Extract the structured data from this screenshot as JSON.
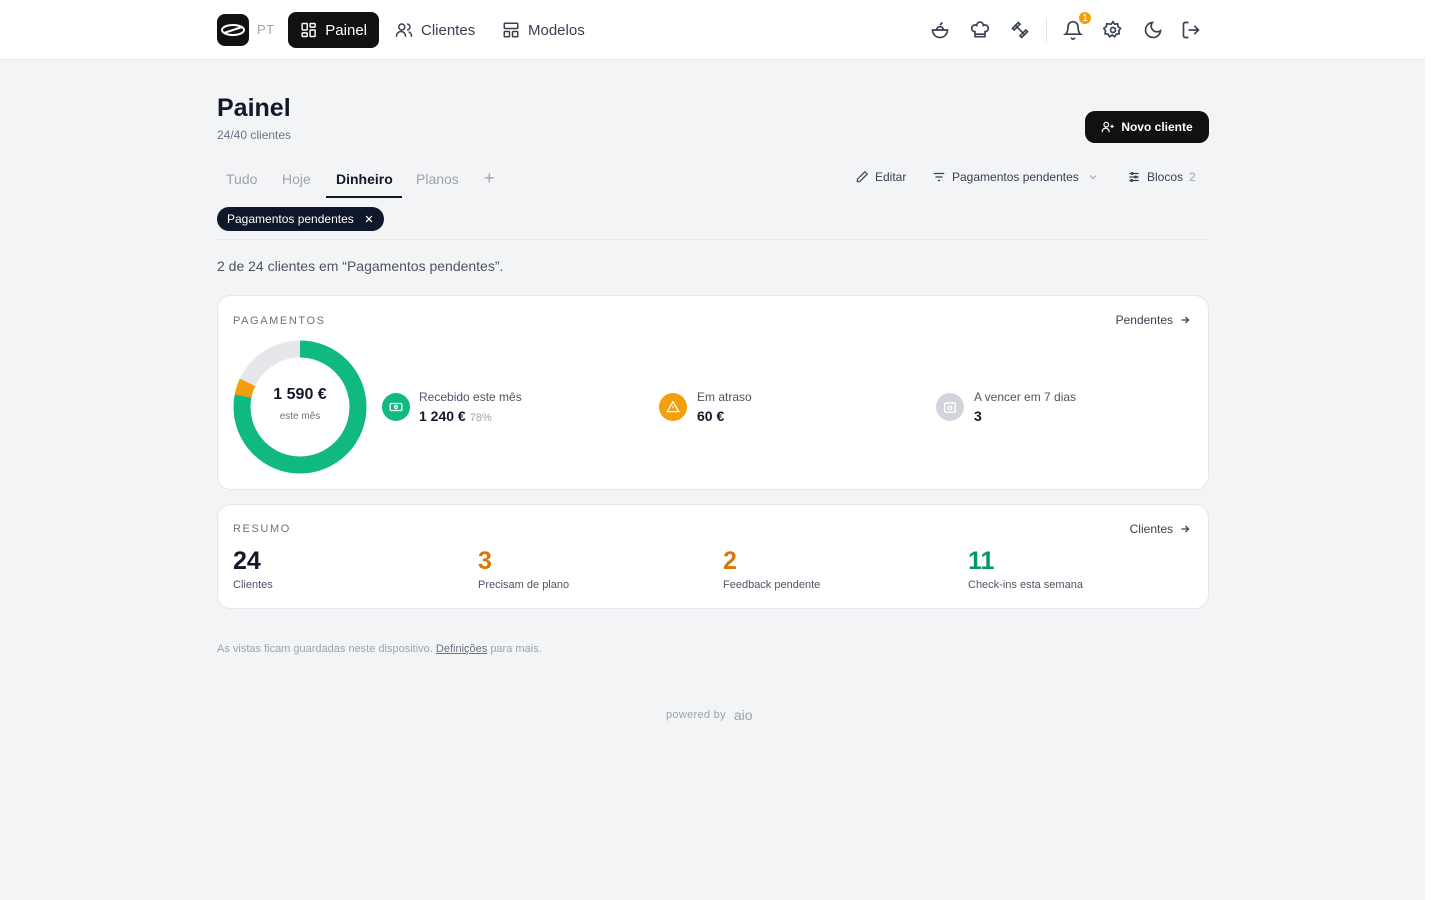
{
  "header": {
    "lang": "PT",
    "nav": [
      {
        "label": "Painel",
        "active": true
      },
      {
        "label": "Clientes",
        "active": false
      },
      {
        "label": "Modelos",
        "active": false
      }
    ],
    "notification_count": "1"
  },
  "page": {
    "title": "Painel",
    "subtitle": "24/40 clientes",
    "new_client_label": "Novo cliente"
  },
  "tabs": [
    {
      "label": "Tudo"
    },
    {
      "label": "Hoje"
    },
    {
      "label": "Dinheiro",
      "active": true
    },
    {
      "label": "Planos"
    }
  ],
  "toolbar": {
    "edit_label": "Editar",
    "filter_label": "Pagamentos pendentes",
    "blocks_label": "Blocos",
    "blocks_count": "2"
  },
  "filter_chip": {
    "label": "Pagamentos pendentes"
  },
  "results_text": "2 de 24 clientes em “Pagamentos pendentes”.",
  "payments": {
    "label": "PAGAMENTOS",
    "link_label": "Pendentes",
    "donut": {
      "total": "1 590 €",
      "sub": "este mês",
      "received_fraction": 0.78,
      "overdue_fraction": 0.04,
      "colors": {
        "received": "#10b981",
        "overdue": "#f59e0b",
        "rest": "#e5e7eb"
      }
    },
    "stats": [
      {
        "label": "Recebido este mês",
        "value": "1 240 €",
        "pct": "78%",
        "icon": "banknote-icon",
        "color": "#10b981"
      },
      {
        "label": "Em atraso",
        "value": "60 €",
        "icon": "warning-icon",
        "color": "#f59e0b"
      },
      {
        "label": "A vencer em 7 dias",
        "value": "3",
        "icon": "calendar-clock-icon",
        "color": "#d1d5db"
      }
    ]
  },
  "summary": {
    "label": "RESUMO",
    "link_label": "Clientes",
    "items": [
      {
        "value": "24",
        "label": "Clientes",
        "color": "#111827"
      },
      {
        "value": "3",
        "label": "Precisam de plano",
        "color": "#d97706"
      },
      {
        "value": "2",
        "label": "Feedback pendente",
        "color": "#d97706"
      },
      {
        "value": "11",
        "label": "Check-ins esta semana",
        "color": "#059669"
      }
    ]
  },
  "footer": {
    "note_prefix": "As vistas ficam guardadas neste dispositivo.",
    "note_link": "Definições",
    "note_suffix": "para mais.",
    "powered_by": "powered by",
    "brand": "aio"
  }
}
